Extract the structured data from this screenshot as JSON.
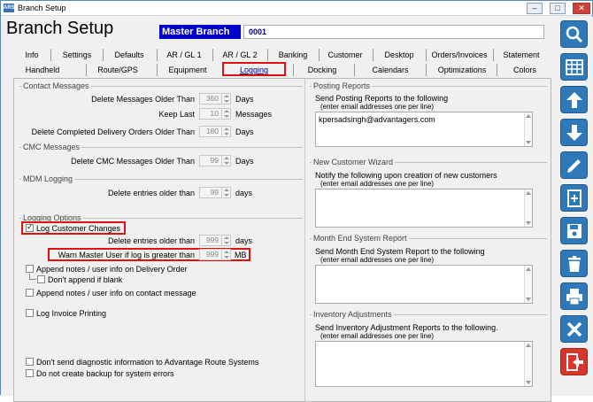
{
  "window": {
    "title": "Branch Setup",
    "app_icon": "ARS",
    "buttons": [
      "–",
      "□",
      "✕"
    ]
  },
  "header": {
    "title": "Branch Setup",
    "branch_name": "Master Branch",
    "branch_code": "0001"
  },
  "tabs": {
    "row1": [
      "Info",
      "Settings",
      "Defaults",
      "AR / GL 1",
      "AR / GL 2",
      "Banking",
      "Customer",
      "Desktop",
      "Orders/Invoices",
      "Statement"
    ],
    "row2": [
      "Handheld",
      "Route/GPS",
      "Equipment",
      "Logging",
      "Docking",
      "Calendars",
      "Optimizations",
      "Colors"
    ],
    "active": "Logging"
  },
  "contact": {
    "title": "Contact Messages",
    "delete_older_label": "Delete Messages Older Than",
    "delete_older_value": "360",
    "delete_older_unit": "Days",
    "keep_last_label": "Keep Last",
    "keep_last_value": "10",
    "keep_last_unit": "Messages",
    "delete_completed_label": "Delete Completed Delivery Orders Older Than",
    "delete_completed_value": "180",
    "delete_completed_unit": "Days"
  },
  "cmc": {
    "title": "CMC Messages",
    "label": "Delete CMC Messages Older Than",
    "value": "99",
    "unit": "Days"
  },
  "mdm": {
    "title": "MDM Logging",
    "label": "Delete entries older than",
    "value": "99",
    "unit": "days"
  },
  "logging": {
    "title": "Logging Options",
    "log_customer_changes": "Log Customer Changes",
    "delete_label": "Delete entries older than",
    "delete_value": "999",
    "delete_unit": "days",
    "warn_label": "Warn Master User if log is greater than",
    "warn_value": "999",
    "warn_unit": "MB",
    "append_delivery": "Append notes / user info on Delivery Order",
    "dont_append_blank": "Don't append if blank",
    "append_contact": "Append notes / user info on contact message",
    "log_invoice_printing": "Log Invoice Printing",
    "dont_send_diag": "Don't send diagnostic information to Advantage Route Systems",
    "no_backup": "Do not create backup for system errors"
  },
  "posting": {
    "title": "Posting Reports",
    "desc": "Send Posting Reports to the following",
    "hint": "(enter email addresses one per line)",
    "value": "kpersadsingh@advantagers.com"
  },
  "new_customer": {
    "title": "New Customer Wizard",
    "desc": "Notify the following upon creation of new customers",
    "hint": "(enter email addresses one per line)",
    "value": ""
  },
  "month_end": {
    "title": "Month End System Report",
    "desc": "Send Month End System Report to the following",
    "hint": "(enter email addresses one per line)",
    "value": ""
  },
  "inventory": {
    "title": "Inventory Adjustments",
    "desc": "Send Inventory Adjustment Reports to the following.",
    "hint": "(enter email addresses one per line)",
    "value": ""
  },
  "toolbar": {
    "icons": [
      "search-icon",
      "grid-icon",
      "arrow-up-icon",
      "arrow-down-icon",
      "pencil-icon",
      "new-document-icon",
      "save-icon",
      "trash-icon",
      "print-icon",
      "close-icon",
      "exit-icon"
    ],
    "accent": "#2f79b9",
    "exit_color": "#d9362b"
  }
}
